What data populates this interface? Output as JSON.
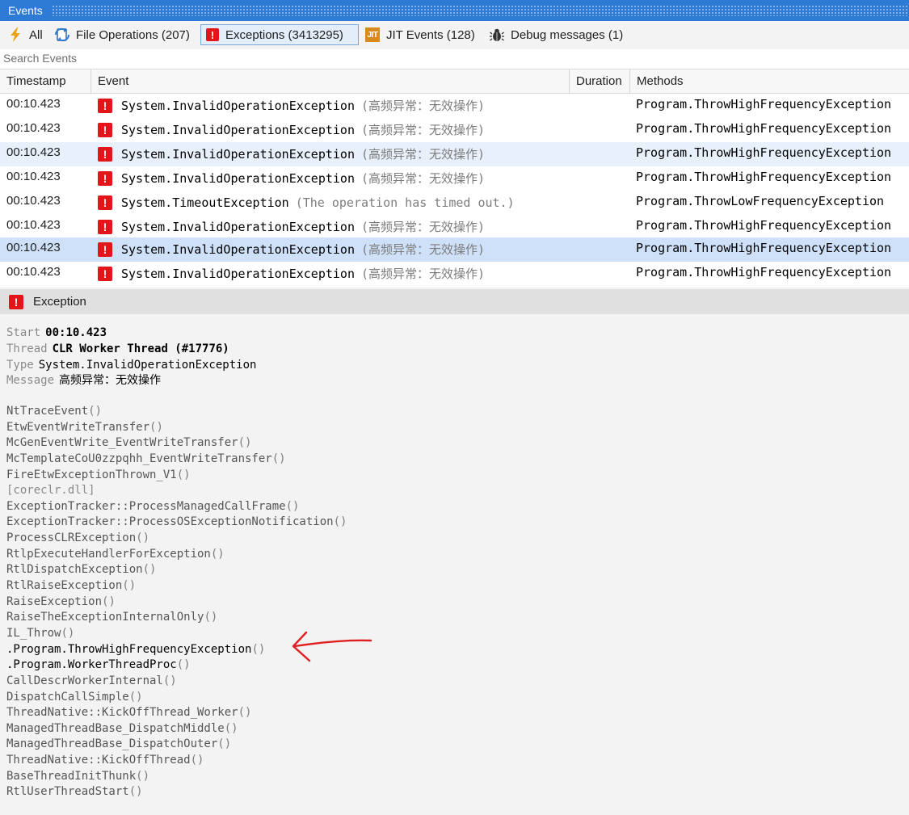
{
  "window": {
    "title": "Events"
  },
  "filters": [
    {
      "label": "All",
      "icon": "lightning-icon"
    },
    {
      "label": "File Operations (207)",
      "icon": "file-operations-icon"
    },
    {
      "label": "Exceptions (3413295)",
      "icon": "exception-icon",
      "active": true
    },
    {
      "label": "JIT Events (128)",
      "icon": "jit-icon"
    },
    {
      "label": "Debug messages (1)",
      "icon": "bug-icon"
    }
  ],
  "search": {
    "placeholder": "Search Events",
    "value": ""
  },
  "columns": {
    "timestamp": "Timestamp",
    "event": "Event",
    "duration": "Duration",
    "methods": "Methods"
  },
  "rows": [
    {
      "timestamp": "00:10.423",
      "name": "System.InvalidOperationException",
      "message": "(高频异常：无效操作)",
      "method": "Program.ThrowHighFrequencyException"
    },
    {
      "timestamp": "00:10.423",
      "name": "System.InvalidOperationException",
      "message": "(高频异常：无效操作)",
      "method": "Program.ThrowHighFrequencyException"
    },
    {
      "timestamp": "00:10.423",
      "name": "System.InvalidOperationException",
      "message": "(高频异常：无效操作)",
      "method": "Program.ThrowHighFrequencyException"
    },
    {
      "timestamp": "00:10.423",
      "name": "System.InvalidOperationException",
      "message": "(高频异常：无效操作)",
      "method": "Program.ThrowHighFrequencyException"
    },
    {
      "timestamp": "00:10.423",
      "name": "System.TimeoutException",
      "message": "(The operation has timed out.)",
      "method": "Program.ThrowLowFrequencyException"
    },
    {
      "timestamp": "00:10.423",
      "name": "System.InvalidOperationException",
      "message": "(高频异常：无效操作)",
      "method": "Program.ThrowHighFrequencyException"
    },
    {
      "timestamp": "00:10.423",
      "name": "System.InvalidOperationException",
      "message": "(高频异常：无效操作)",
      "method": "Program.ThrowHighFrequencyException"
    },
    {
      "timestamp": "00:10.423",
      "name": "System.InvalidOperationException",
      "message": "(高频异常：无效操作)",
      "method": "Program.ThrowHighFrequencyException"
    }
  ],
  "detail": {
    "header": "Exception",
    "start_label": "Start",
    "start_value": "00:10.423",
    "thread_label": "Thread",
    "thread_value": "CLR Worker Thread (#17776)",
    "type_label": "Type",
    "type_value": "System.InvalidOperationException",
    "message_label": "Message",
    "message_value": "高频异常：无效操作",
    "stack": [
      {
        "fn": "NtTraceEvent",
        "suffix": "()"
      },
      {
        "fn": "EtwEventWriteTransfer",
        "suffix": "()"
      },
      {
        "fn": "McGenEventWrite_EventWriteTransfer",
        "suffix": "()"
      },
      {
        "fn": "McTemplateCoU0zzpqhh_EventWriteTransfer",
        "suffix": "()"
      },
      {
        "fn": "FireEtwExceptionThrown_V1",
        "suffix": "()"
      },
      {
        "fn": "[coreclr.dll]",
        "suffix": "",
        "dim": true
      },
      {
        "fn": "ExceptionTracker::ProcessManagedCallFrame",
        "suffix": "()"
      },
      {
        "fn": "ExceptionTracker::ProcessOSExceptionNotification",
        "suffix": "()"
      },
      {
        "fn": "ProcessCLRException",
        "suffix": "()"
      },
      {
        "fn": "RtlpExecuteHandlerForException",
        "suffix": "()"
      },
      {
        "fn": "RtlDispatchException",
        "suffix": "()"
      },
      {
        "fn": "RtlRaiseException",
        "suffix": "()"
      },
      {
        "fn": "RaiseException",
        "suffix": "()"
      },
      {
        "fn": "RaiseTheExceptionInternalOnly",
        "suffix": "()"
      },
      {
        "fn": "IL_Throw",
        "suffix": "()"
      },
      {
        "ns": ".Program.",
        "fn": "ThrowHighFrequencyException",
        "suffix": "()",
        "user": true
      },
      {
        "ns": ".Program.",
        "fn": "WorkerThreadProc",
        "suffix": "()",
        "user": true
      },
      {
        "fn": "CallDescrWorkerInternal",
        "suffix": "()"
      },
      {
        "fn": "DispatchCallSimple",
        "suffix": "()"
      },
      {
        "fn": "ThreadNative::KickOffThread_Worker",
        "suffix": "()"
      },
      {
        "fn": "ManagedThreadBase_DispatchMiddle",
        "suffix": "()"
      },
      {
        "fn": "ManagedThreadBase_DispatchOuter",
        "suffix": "()"
      },
      {
        "fn": "ThreadNative::KickOffThread",
        "suffix": "()"
      },
      {
        "fn": "BaseThreadInitThunk",
        "suffix": "()"
      },
      {
        "fn": "RtlUserThreadStart",
        "suffix": "()"
      }
    ]
  },
  "colors": {
    "accent": "#2d7bd4",
    "exception": "#e3151a",
    "selected_row": "#cfe1f8",
    "alt_row": "#e8f0fb",
    "annotation": "#e02020"
  }
}
